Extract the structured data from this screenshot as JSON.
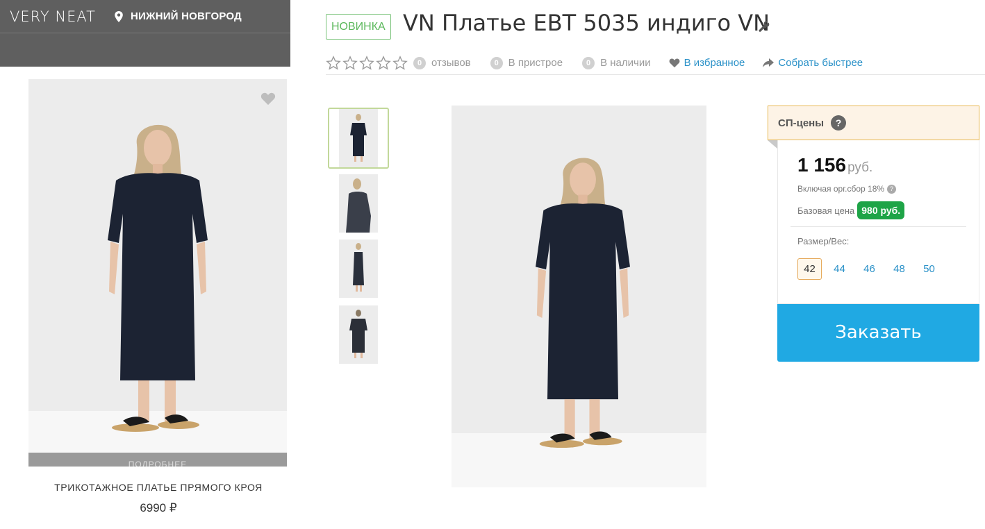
{
  "store": {
    "brand": "VERY NEAT",
    "city": "НИЖНИЙ НОВГОРОД",
    "featured": {
      "more_label": "ПОДРОБНЕЕ",
      "title": "ТРИКОТАЖНОЕ ПЛАТЬЕ ПРЯМОГО КРОЯ",
      "price": "6990 ₽"
    }
  },
  "product": {
    "badge": "НОВИНКА",
    "title": "VN Платье EBT 5035 индиго VN",
    "rating": {
      "value": 0,
      "max": 5
    },
    "meta": {
      "reviews_count": "0",
      "reviews_label": "отзывов",
      "attached_count": "0",
      "attached_label": "В пристрое",
      "stock_count": "0",
      "stock_label": "В наличии",
      "favorite_label": "В избранное",
      "faster_label": "Собрать быстрее"
    }
  },
  "pricing": {
    "header": "СП-цены",
    "help": "?",
    "price": "1 156",
    "currency": "руб.",
    "fee_note": "Включая орг.сбор 18%",
    "base_label": "Базовая цена",
    "base_price": "980 руб.",
    "size_label": "Размер/Вес:",
    "sizes": [
      "42",
      "44",
      "46",
      "48",
      "50"
    ],
    "selected_size": "42",
    "order_label": "Заказать"
  },
  "colors": {
    "accent": "#20a9e3",
    "new_badge": "#5cb85c",
    "base_badge": "#1ea447",
    "header_bg": "#5f5f5f",
    "dress": "#1c2333"
  }
}
